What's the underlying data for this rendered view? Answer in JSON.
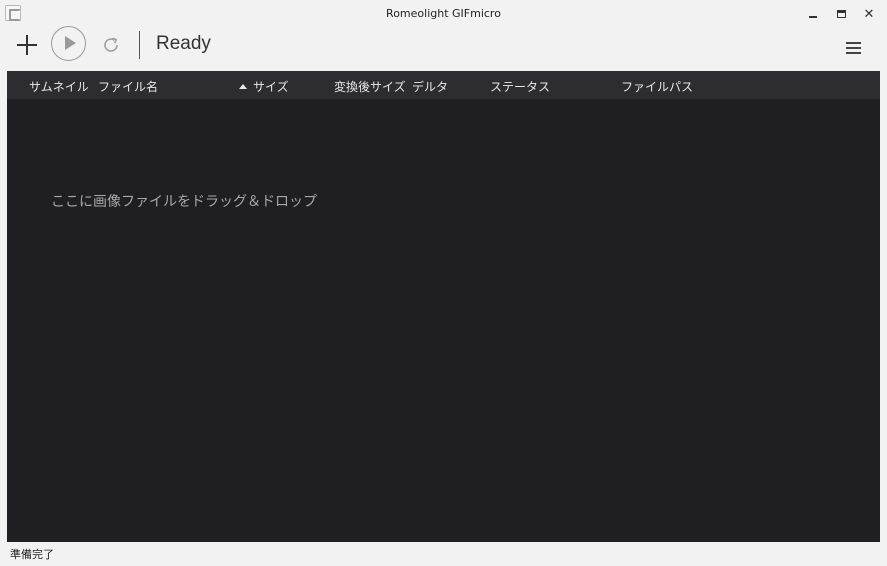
{
  "window": {
    "title": "Romeolight GIFmicro",
    "close_glyph": "✕"
  },
  "toolbar": {
    "status": "Ready",
    "icons": [
      "add-icon",
      "play-icon",
      "refresh-icon",
      "hamburger-menu-icon"
    ]
  },
  "list": {
    "columns": [
      "サムネイル",
      "ファイル名",
      "サイズ",
      "変換後サイズ",
      "デルタ",
      "ステータス",
      "ファイルパス"
    ],
    "sort_column": "サイズ",
    "sort_direction": "ascending",
    "drop_hint": "ここに画像ファイルをドラッグ＆ドロップ"
  },
  "statusbar": {
    "text": "準備完了"
  },
  "colors": {
    "list_bg": "#1f1f21",
    "header_bg": "#2d2d30",
    "chrome_bg": "#f2f2f2"
  }
}
